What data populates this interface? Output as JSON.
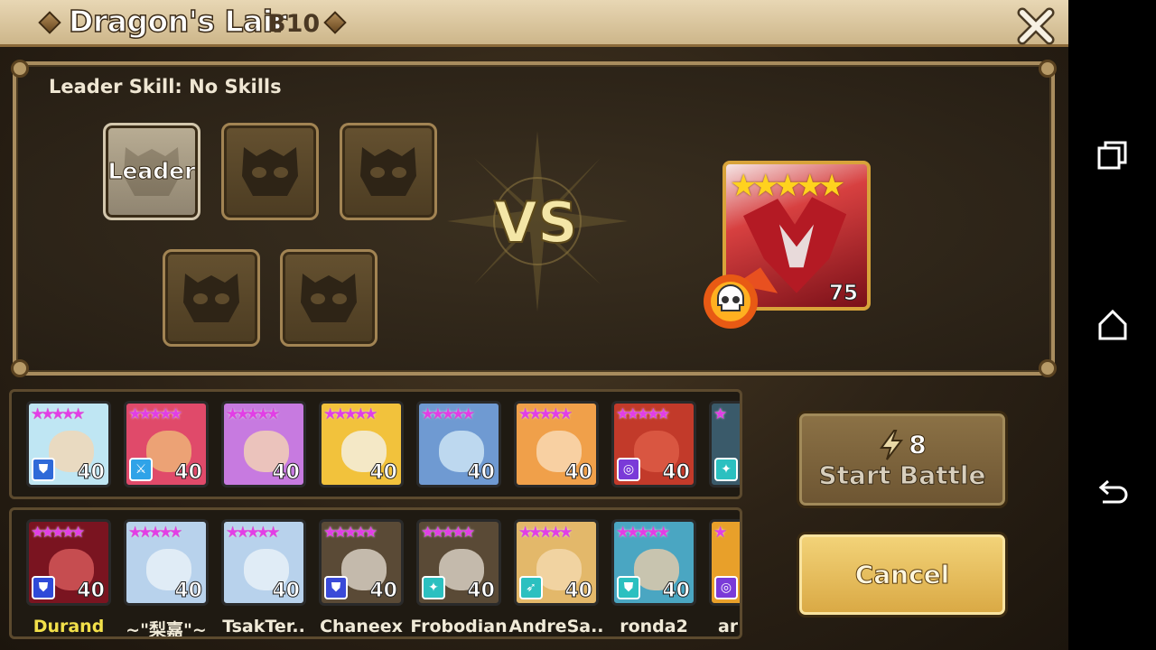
{
  "header": {
    "title": "Dragon's Lair",
    "floor": "B10"
  },
  "team": {
    "leader_skill": "Leader Skill: No Skills",
    "slots": [
      {
        "label": "Leader"
      },
      {
        "label": ""
      },
      {
        "label": ""
      },
      {
        "label": ""
      },
      {
        "label": ""
      }
    ]
  },
  "versus": {
    "label": "VS"
  },
  "boss": {
    "stars": 5,
    "level": "75",
    "icon": "skull-icon"
  },
  "monster_rows": [
    {
      "items": [
        {
          "stars": "★★★★★",
          "level": "40",
          "rune": "shield-icon",
          "rune_color": "#2f6ad8",
          "bg": "#bfe6f3"
        },
        {
          "stars": "★★★★★",
          "level": "40",
          "rune": "sword-icon",
          "rune_color": "#2fa3e8",
          "bg": "#e04a6a"
        },
        {
          "stars": "★★★★★",
          "level": "40",
          "rune": "",
          "rune_color": "",
          "bg": "#c77ae0"
        },
        {
          "stars": "★★★★★",
          "level": "40",
          "rune": "",
          "rune_color": "",
          "bg": "#f2c23c"
        },
        {
          "stars": "★★★★★",
          "level": "40",
          "rune": "",
          "rune_color": "",
          "bg": "#6f9ad2"
        },
        {
          "stars": "★★★★★",
          "level": "40",
          "rune": "",
          "rune_color": "",
          "bg": "#f0a04a"
        },
        {
          "stars": "★★★★★",
          "level": "40",
          "rune": "target-icon",
          "rune_color": "#7a3ad8",
          "bg": "#c23a2a"
        },
        {
          "stars": "★",
          "level": "",
          "rune": "figure-icon",
          "rune_color": "#2bc0c0",
          "bg": "#3a5a6a"
        }
      ]
    },
    {
      "items": [
        {
          "stars": "★★★★★",
          "level": "40",
          "rune": "shield-icon",
          "rune_color": "#2f4ad8",
          "bg": "#7a1420",
          "name": "Durand",
          "gold": true
        },
        {
          "stars": "★★★★★",
          "level": "40",
          "rune": "",
          "rune_color": "",
          "bg": "#b8d2ec",
          "name": "~\"梨嘉\"~"
        },
        {
          "stars": "★★★★★",
          "level": "40",
          "rune": "",
          "rune_color": "",
          "bg": "#b8d2ec",
          "name": "TsakTer.."
        },
        {
          "stars": "★★★★★",
          "level": "40",
          "rune": "shield-icon",
          "rune_color": "#3a4ad8",
          "bg": "#5a4a36",
          "name": "Chaneex"
        },
        {
          "stars": "★★★★★",
          "level": "40",
          "rune": "figure-icon",
          "rune_color": "#2bc0c0",
          "bg": "#5a4a36",
          "name": "Frobodian"
        },
        {
          "stars": "★★★★★",
          "level": "40",
          "rune": "feather-icon",
          "rune_color": "#2bc0c0",
          "bg": "#e3b86a",
          "name": "AndreSa.."
        },
        {
          "stars": "★★★★★",
          "level": "40",
          "rune": "shield-icon",
          "rune_color": "#2bc0c0",
          "bg": "#4aa6c2",
          "name": "ronda2"
        },
        {
          "stars": "★",
          "level": "",
          "rune": "target-icon",
          "rune_color": "#7a3ad8",
          "bg": "#e8a02a",
          "name": "ar"
        }
      ]
    }
  ],
  "actions": {
    "start": {
      "cost": "8",
      "label": "Start Battle",
      "icon": "energy-bolt-icon"
    },
    "cancel": {
      "label": "Cancel"
    }
  },
  "system_nav": {
    "icons": [
      "recent-apps-icon",
      "home-icon",
      "back-icon"
    ]
  }
}
